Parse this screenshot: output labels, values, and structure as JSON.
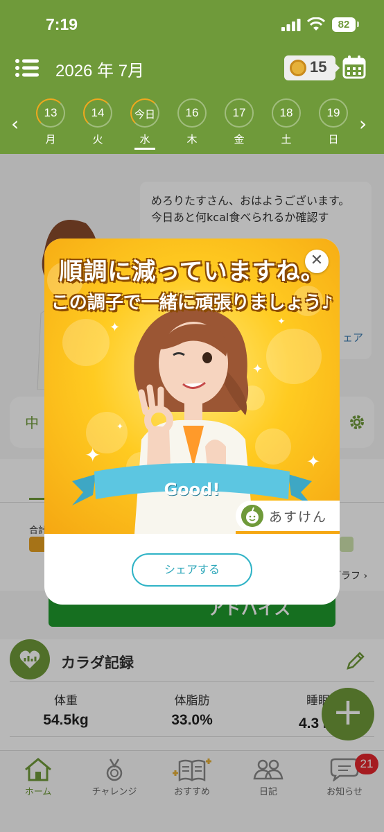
{
  "status_bar": {
    "time": "7:19",
    "battery": "82"
  },
  "header": {
    "month": "2026 年 7月",
    "medal_count": "15",
    "days": [
      {
        "num": "13",
        "wd": "月"
      },
      {
        "num": "14",
        "wd": "火"
      },
      {
        "num": "今日",
        "wd": "水"
      },
      {
        "num": "16",
        "wd": "木"
      },
      {
        "num": "17",
        "wd": "金"
      },
      {
        "num": "18",
        "wd": "土"
      },
      {
        "num": "19",
        "wd": "日"
      }
    ]
  },
  "background": {
    "bubble_line1": "めろりたすさん、おはようございます。",
    "bubble_line2": "今日あと何kcal食べられるか確認す",
    "bubble_tail": "ェア",
    "chu_label": "中",
    "total_label": "合計",
    "graph_link": "グラフ ›",
    "advice_label": "アドバイス",
    "body_record_title": "カラダ記録",
    "metrics": [
      {
        "label": "体重",
        "value": "54.5kg"
      },
      {
        "label": "体脂肪",
        "value": "33.0%"
      },
      {
        "label": "睡眠",
        "value": "4.3 時"
      }
    ]
  },
  "popup": {
    "title_line1": "順調に減っていますね。",
    "title_line2": "この調子で一緒に頑張りましょう♪",
    "ribbon_text": "Good!",
    "brand": "あすけん",
    "share_button": "シェアする",
    "close_icon": "close-icon"
  },
  "nav": {
    "items": [
      {
        "label": "ホーム",
        "icon": "home-icon"
      },
      {
        "label": "チャレンジ",
        "icon": "medal-icon"
      },
      {
        "label": "おすすめ",
        "icon": "book-icon"
      },
      {
        "label": "日記",
        "icon": "people-icon"
      },
      {
        "label": "お知らせ",
        "icon": "chat-icon"
      }
    ],
    "badge": "21"
  },
  "colors": {
    "brand_green": "#6f9a3a",
    "accent_orange": "#f0a81e",
    "share_teal": "#2fb3c6"
  }
}
